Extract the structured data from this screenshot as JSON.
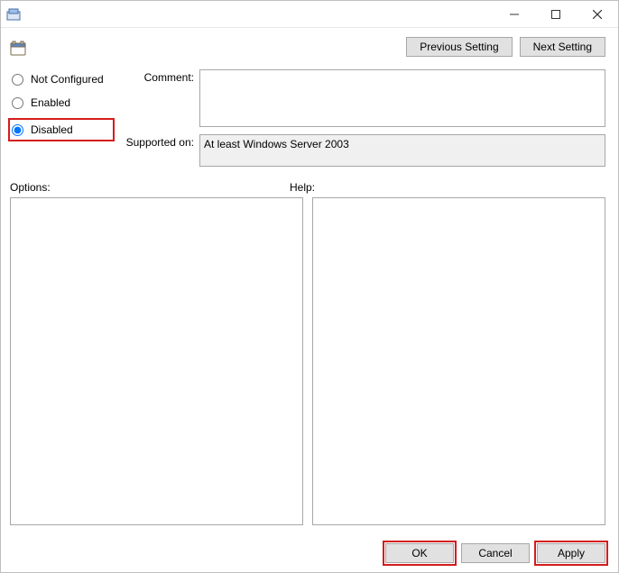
{
  "window": {
    "title": ""
  },
  "nav": {
    "previous_label": "Previous Setting",
    "next_label": "Next Setting"
  },
  "radios": {
    "not_configured": "Not Configured",
    "enabled": "Enabled",
    "disabled": "Disabled",
    "selected": "disabled"
  },
  "fields": {
    "comment_label": "Comment:",
    "comment_value": "",
    "supported_label": "Supported on:",
    "supported_value": "At least Windows Server 2003"
  },
  "panes": {
    "options_label": "Options:",
    "help_label": "Help:",
    "options_content": "",
    "help_content": ""
  },
  "footer": {
    "ok": "OK",
    "cancel": "Cancel",
    "apply": "Apply"
  }
}
